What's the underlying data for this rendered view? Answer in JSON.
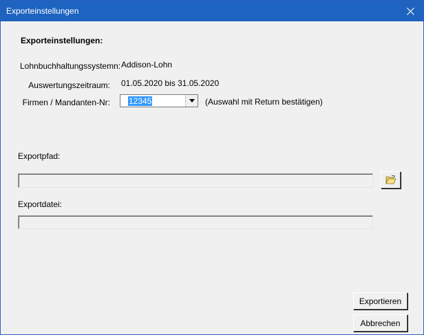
{
  "window": {
    "title": "Exporteinstellungen"
  },
  "heading": "Exporteinstellungen:",
  "lohn": {
    "label": "Lohnbuchhaltungssystemn:",
    "value": "Addison-Lohn"
  },
  "zeitraum": {
    "label": "Auswertungszeitraum:",
    "value": "01.05.2020 bis 31.05.2020"
  },
  "firma": {
    "label": "Firmen / Mandanten-Nr:",
    "selected": "12345",
    "hint": "(Auswahl mit Return bestätigen)"
  },
  "exportpfad": {
    "label": "Exportpfad:",
    "value": ""
  },
  "exportdatei": {
    "label": "Exportdatei:",
    "value": ""
  },
  "buttons": {
    "export": "Exportieren",
    "cancel": "Abbrechen"
  },
  "icons": {
    "close": "close-icon",
    "dropdown": "chevron-down-icon",
    "browse": "open-folder-icon"
  }
}
